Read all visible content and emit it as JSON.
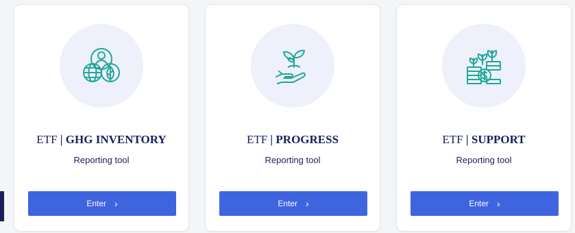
{
  "colors": {
    "accent": "#3e64df",
    "title": "#1a1f5c",
    "icon": "#1fa79a",
    "icon_bg": "#eef0fb"
  },
  "cards": [
    {
      "prefix": "ETF",
      "separator": " | ",
      "title": "GHG INVENTORY",
      "subtitle": "Reporting tool",
      "button": "Enter",
      "button_icon": "chevron-right-icon",
      "icon": "globe-person-leaf-icon"
    },
    {
      "prefix": "ETF",
      "separator": " | ",
      "title": "PROGRESS",
      "subtitle": "Reporting tool",
      "button": "Enter",
      "button_icon": "chevron-right-icon",
      "icon": "hand-sprout-icon"
    },
    {
      "prefix": "ETF",
      "separator": " | ",
      "title": "SUPPORT",
      "subtitle": "Reporting tool",
      "button": "Enter",
      "button_icon": "chevron-right-icon",
      "icon": "coins-plants-icon"
    }
  ]
}
